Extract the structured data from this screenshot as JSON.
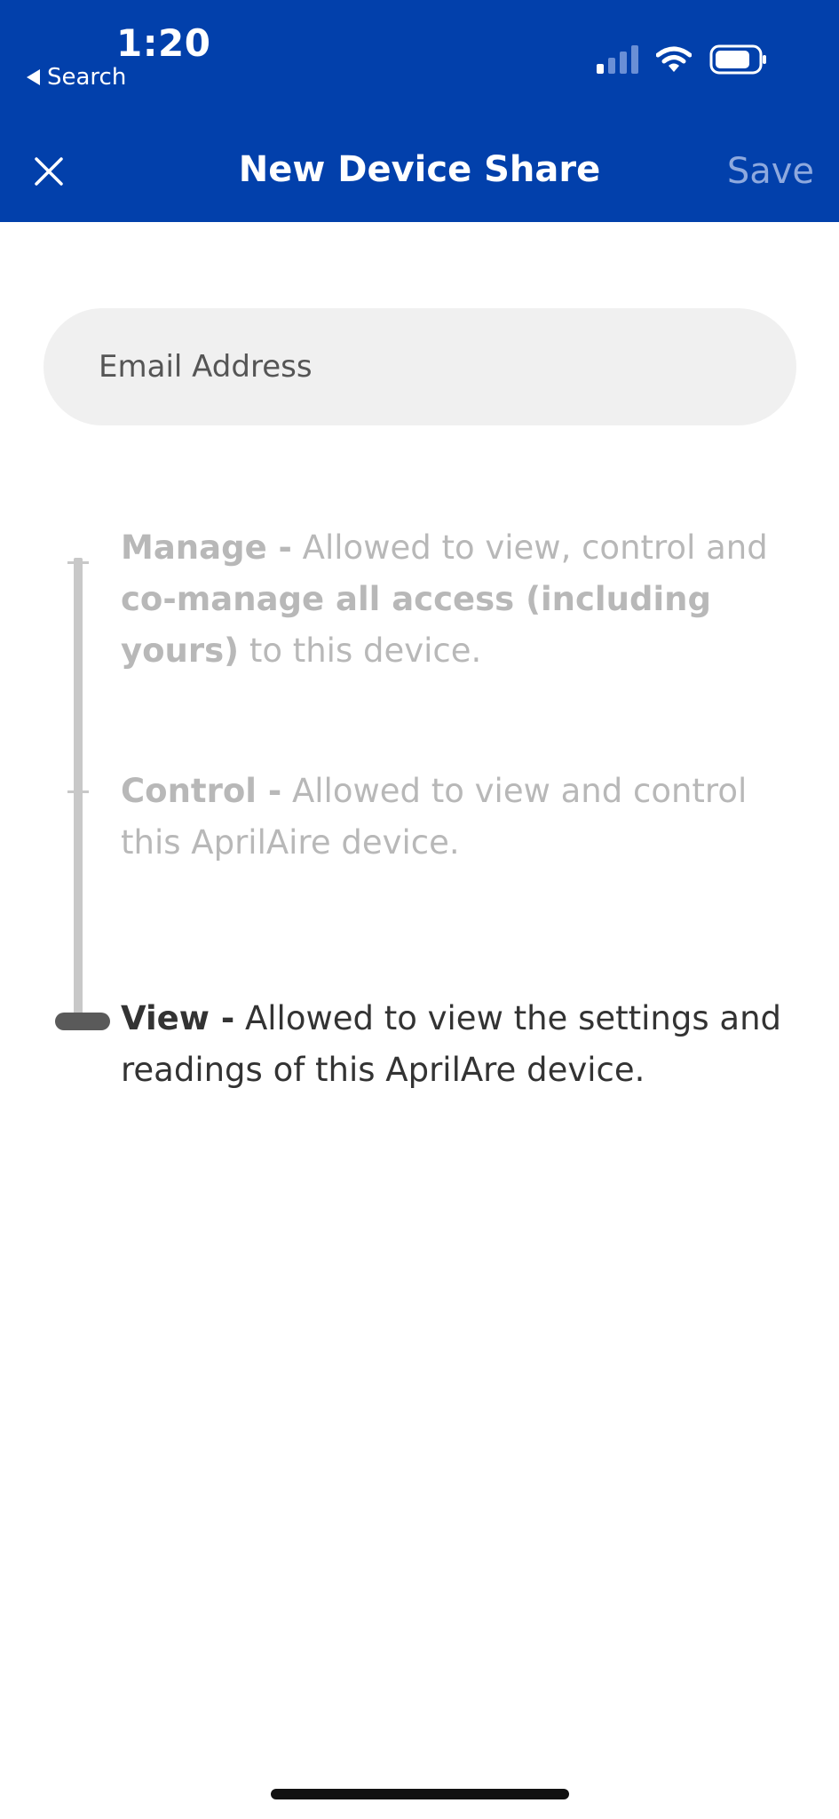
{
  "status_bar": {
    "time": "1:20",
    "back_label": "Search"
  },
  "header": {
    "title": "New Device Share",
    "save_label": "Save"
  },
  "email": {
    "placeholder": "Email Address",
    "value": ""
  },
  "access_levels": [
    {
      "name": "Manage -",
      "text_before": " Allowed to view, control and ",
      "bold_middle": "co-manage all access (including yours)",
      "text_after": " to this device."
    },
    {
      "name": "Control -",
      "text_before": " Allowed to view and control this AprilAire device."
    },
    {
      "name": "View -",
      "text_before": " Allowed to view the settings and readings of this AprilAre device."
    }
  ],
  "selected_level": "View",
  "colors": {
    "header_bg": "#0240ab",
    "save_disabled": "#8ea9de",
    "input_bg": "#f0f0f0",
    "dim_text": "#b8b8b8",
    "active_text": "#333333"
  }
}
